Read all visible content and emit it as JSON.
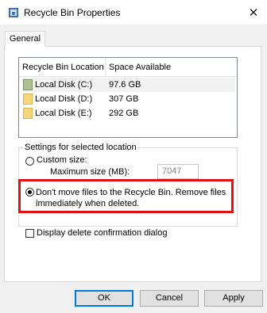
{
  "window": {
    "title": "Recycle Bin Properties",
    "close_glyph": "✕"
  },
  "tabs": [
    {
      "label": "General"
    }
  ],
  "list": {
    "columns": [
      "Recycle Bin Location",
      "Space Available"
    ],
    "rows": [
      {
        "name": "Local Disk (C:)",
        "space": "97.6 GB",
        "icon": "system-drive-icon"
      },
      {
        "name": "Local Disk (D:)",
        "space": "307 GB",
        "icon": "drive-icon"
      },
      {
        "name": "Local Disk (E:)",
        "space": "292 GB",
        "icon": "drive-icon"
      }
    ]
  },
  "settings": {
    "group_label": "Settings for selected location",
    "custom_size_label": "Custom size:",
    "max_size_label": "Maximum size (MB):",
    "max_size_value": "7047",
    "dont_move_label": "Don't move files to the Recycle Bin. Remove files immediately when deleted.",
    "confirm_label": "Display delete confirmation dialog"
  },
  "buttons": {
    "ok": "OK",
    "cancel": "Cancel",
    "apply": "Apply"
  },
  "colors": {
    "highlight": "#e21010",
    "accent": "#0078d7",
    "drive_yellow": "#f6d67a",
    "drive_green": "#a9c28f"
  }
}
